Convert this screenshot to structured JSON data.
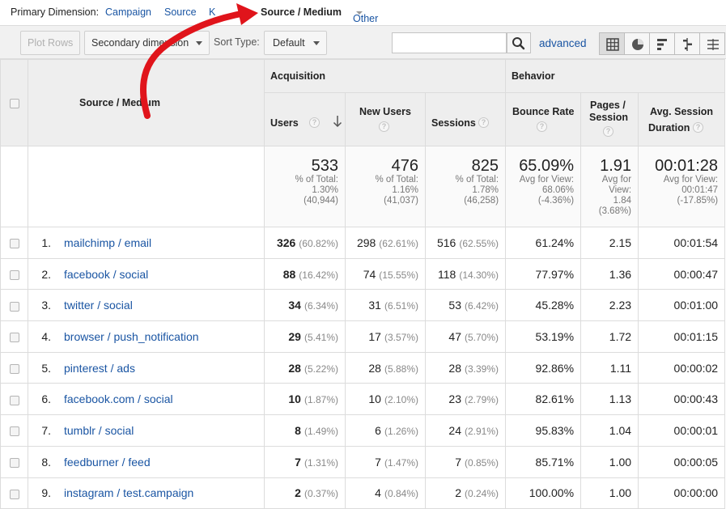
{
  "primary_dimension": {
    "label": "Primary Dimension:",
    "options": [
      {
        "label": "Campaign",
        "active": false
      },
      {
        "label": "Source",
        "active": false
      },
      {
        "label": "Source / Medium",
        "active": true
      },
      {
        "label": "Other",
        "active": false
      }
    ],
    "partial_label": "K"
  },
  "toolbar": {
    "plot_rows": "Plot Rows",
    "secondary_dimension": "Secondary dimension",
    "sort_type_label": "Sort Type:",
    "sort_type_value": "Default",
    "search_placeholder": "",
    "advanced": "advanced",
    "view_icons": [
      "table-view-icon",
      "pie-view-icon",
      "performance-view-icon",
      "comparison-view-icon",
      "pivot-view-icon"
    ]
  },
  "table": {
    "dimension_header": "Source / Medium",
    "groups": {
      "acquisition": "Acquisition",
      "behavior": "Behavior"
    },
    "columns": {
      "users": "Users",
      "new_users": "New Users",
      "sessions": "Sessions",
      "bounce_rate": "Bounce Rate",
      "pages_session_1": "Pages /",
      "pages_session_2": "Session",
      "avg_session_1": "Avg. Session",
      "avg_session_2": "Duration"
    },
    "help_glyph": "?",
    "totals": {
      "users": {
        "value": "533",
        "l1": "% of Total:",
        "l2": "1.30%",
        "l3": "(40,944)"
      },
      "new_users": {
        "value": "476",
        "l1": "% of Total:",
        "l2": "1.16%",
        "l3": "(41,037)"
      },
      "sessions": {
        "value": "825",
        "l1": "% of Total:",
        "l2": "1.78%",
        "l3": "(46,258)"
      },
      "bounce_rate": {
        "value": "65.09%",
        "l1": "Avg for View:",
        "l2": "68.06%",
        "l3": "(-4.36%)"
      },
      "pages_session": {
        "value": "1.91",
        "l1": "Avg for",
        "l2": "View:",
        "l3": "1.84",
        "l4": "(3.68%)"
      },
      "avg_session": {
        "value": "00:01:28",
        "l1": "Avg for View:",
        "l2": "00:01:47",
        "l3": "(-17.85%)"
      }
    },
    "rows": [
      {
        "n": "1.",
        "source": "mailchimp / email",
        "users": "326",
        "users_pct": "(60.82%)",
        "new_users": "298",
        "new_users_pct": "(62.61%)",
        "sessions": "516",
        "sessions_pct": "(62.55%)",
        "bounce": "61.24%",
        "pages": "2.15",
        "duration": "00:01:54"
      },
      {
        "n": "2.",
        "source": "facebook / social",
        "users": "88",
        "users_pct": "(16.42%)",
        "new_users": "74",
        "new_users_pct": "(15.55%)",
        "sessions": "118",
        "sessions_pct": "(14.30%)",
        "bounce": "77.97%",
        "pages": "1.36",
        "duration": "00:00:47"
      },
      {
        "n": "3.",
        "source": "twitter / social",
        "users": "34",
        "users_pct": "(6.34%)",
        "new_users": "31",
        "new_users_pct": "(6.51%)",
        "sessions": "53",
        "sessions_pct": "(6.42%)",
        "bounce": "45.28%",
        "pages": "2.23",
        "duration": "00:01:00"
      },
      {
        "n": "4.",
        "source": "browser / push_notification",
        "users": "29",
        "users_pct": "(5.41%)",
        "new_users": "17",
        "new_users_pct": "(3.57%)",
        "sessions": "47",
        "sessions_pct": "(5.70%)",
        "bounce": "53.19%",
        "pages": "1.72",
        "duration": "00:01:15"
      },
      {
        "n": "5.",
        "source": "pinterest / ads",
        "users": "28",
        "users_pct": "(5.22%)",
        "new_users": "28",
        "new_users_pct": "(5.88%)",
        "sessions": "28",
        "sessions_pct": "(3.39%)",
        "bounce": "92.86%",
        "pages": "1.11",
        "duration": "00:00:02"
      },
      {
        "n": "6.",
        "source": "facebook.com / social",
        "users": "10",
        "users_pct": "(1.87%)",
        "new_users": "10",
        "new_users_pct": "(2.10%)",
        "sessions": "23",
        "sessions_pct": "(2.79%)",
        "bounce": "82.61%",
        "pages": "1.13",
        "duration": "00:00:43"
      },
      {
        "n": "7.",
        "source": "tumblr / social",
        "users": "8",
        "users_pct": "(1.49%)",
        "new_users": "6",
        "new_users_pct": "(1.26%)",
        "sessions": "24",
        "sessions_pct": "(2.91%)",
        "bounce": "95.83%",
        "pages": "1.04",
        "duration": "00:00:01"
      },
      {
        "n": "8.",
        "source": "feedburner / feed",
        "users": "7",
        "users_pct": "(1.31%)",
        "new_users": "7",
        "new_users_pct": "(1.47%)",
        "sessions": "7",
        "sessions_pct": "(0.85%)",
        "bounce": "85.71%",
        "pages": "1.00",
        "duration": "00:00:05"
      },
      {
        "n": "9.",
        "source": "instagram / test.campaign",
        "users": "2",
        "users_pct": "(0.37%)",
        "new_users": "4",
        "new_users_pct": "(0.84%)",
        "sessions": "2",
        "sessions_pct": "(0.24%)",
        "bounce": "100.00%",
        "pages": "1.00",
        "duration": "00:00:00"
      }
    ]
  },
  "annotation": {
    "color": "#e0141b"
  }
}
